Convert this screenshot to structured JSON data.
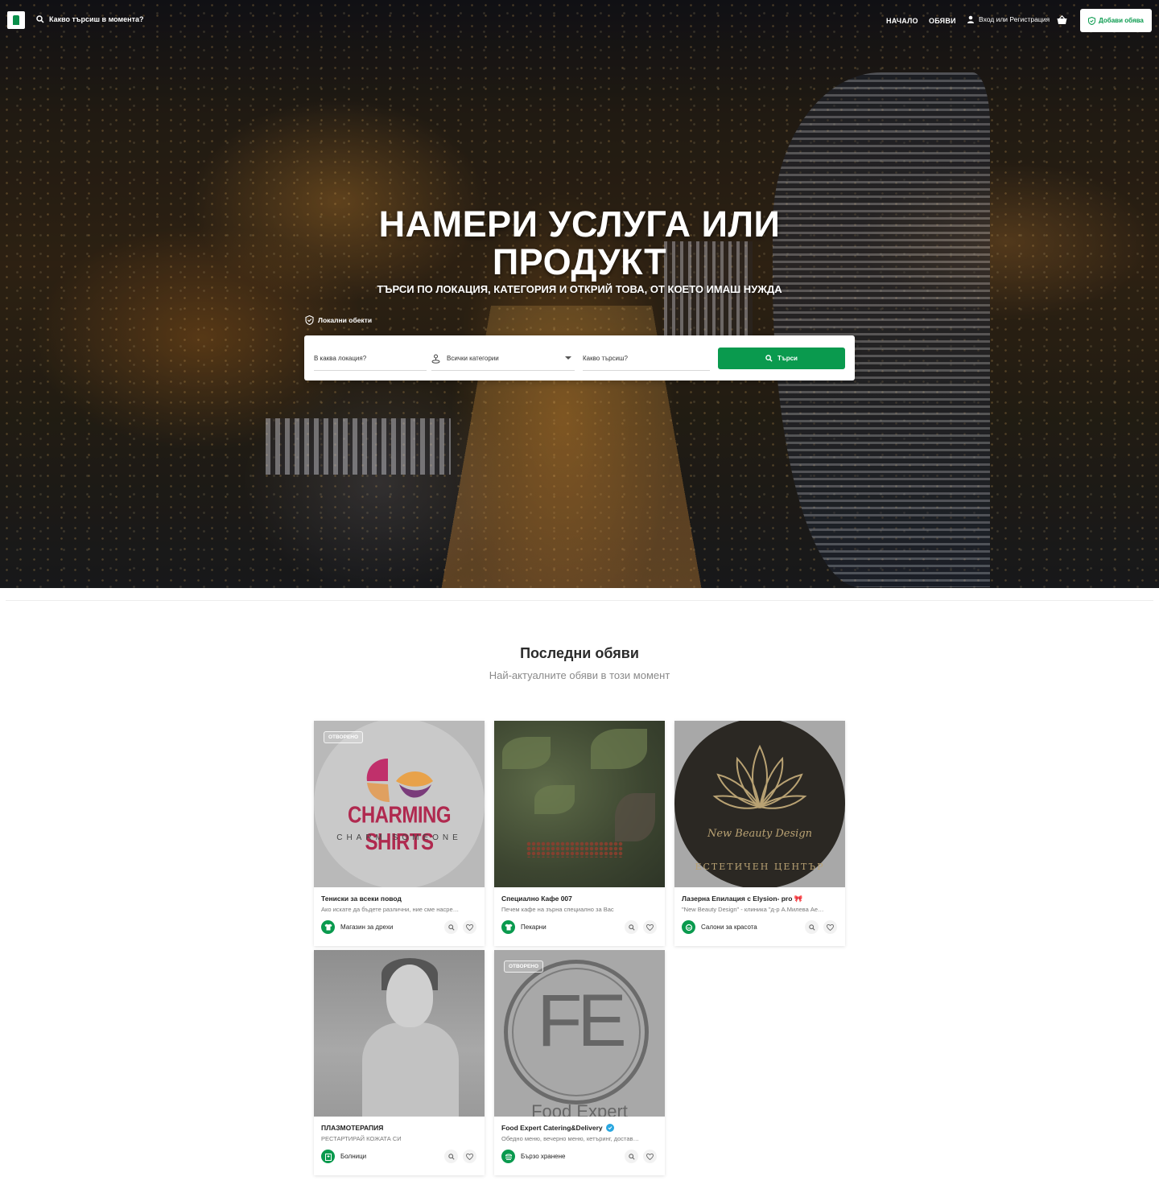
{
  "header": {
    "search_label": "Какво търсиш в момента?",
    "nav_home": "НАЧАЛО",
    "nav_listings": "ОБЯВИ",
    "login_label": "Вход или Регистрация",
    "add_button": "Добави обява"
  },
  "hero": {
    "title": "НАМЕРИ УСЛУГА ИЛИ ПРОДУКТ",
    "subtitle": "ТЪРСИ ПО ЛОКАЦИЯ, КАТЕГОРИЯ И ОТКРИЙ ТОВА, ОТ КОЕТО ИМАШ НУЖДА",
    "tab_label": "Локални обекти",
    "search": {
      "location_placeholder": "В каква локация?",
      "category_value": "Всички категории",
      "query_placeholder": "Какво търсиш?",
      "button_label": "Търси"
    }
  },
  "section": {
    "title": "Последни обяви",
    "subtitle": "Най-актуалните обяви в този момент"
  },
  "cards": [
    {
      "badge": "ОТВОРЕНО",
      "image_text": "CHARMING SHIRTS",
      "image_subtext": "CHARM SOMEONE",
      "title": "Тениски за всеки повод",
      "description": "Ако искате да бъдете различни, ние сме насре…",
      "category": "Магазин за дрехи",
      "category_icon": "shirt-icon"
    },
    {
      "title": "Специално Кафе 007",
      "description": "Печем кафе на зърна специално за Вас",
      "category": "Пекарни",
      "category_icon": "shirt-icon"
    },
    {
      "image_text": "New Beauty Design",
      "image_subtext": "ЕСТЕТИЧЕН ЦЕНТЪР",
      "title": "Лазерна Епилация с Elysion- pro 🎀",
      "description": "\"New Beauty Design\" - клиника \"д-р А.Милева Ае…",
      "category": "Салони за красота",
      "category_icon": "beauty-icon"
    },
    {
      "title": "ПЛАЗМОТЕРАПИЯ",
      "description": "РЕСТАРТИРАЙ КОЖАТА СИ",
      "category": "Болници",
      "category_icon": "hospital-icon"
    },
    {
      "badge": "ОТВОРЕНО",
      "image_text": "FE",
      "image_subtext": "Food Expert",
      "title": "Food Expert Catering&Delivery",
      "verified": true,
      "description": "Обедно меню, вечерно меню, кетъринг, достав…",
      "category": "Бързо хранене",
      "category_icon": "food-icon"
    }
  ],
  "colors": {
    "accent": "#0a9a4e",
    "verified": "#2aa7e0"
  }
}
